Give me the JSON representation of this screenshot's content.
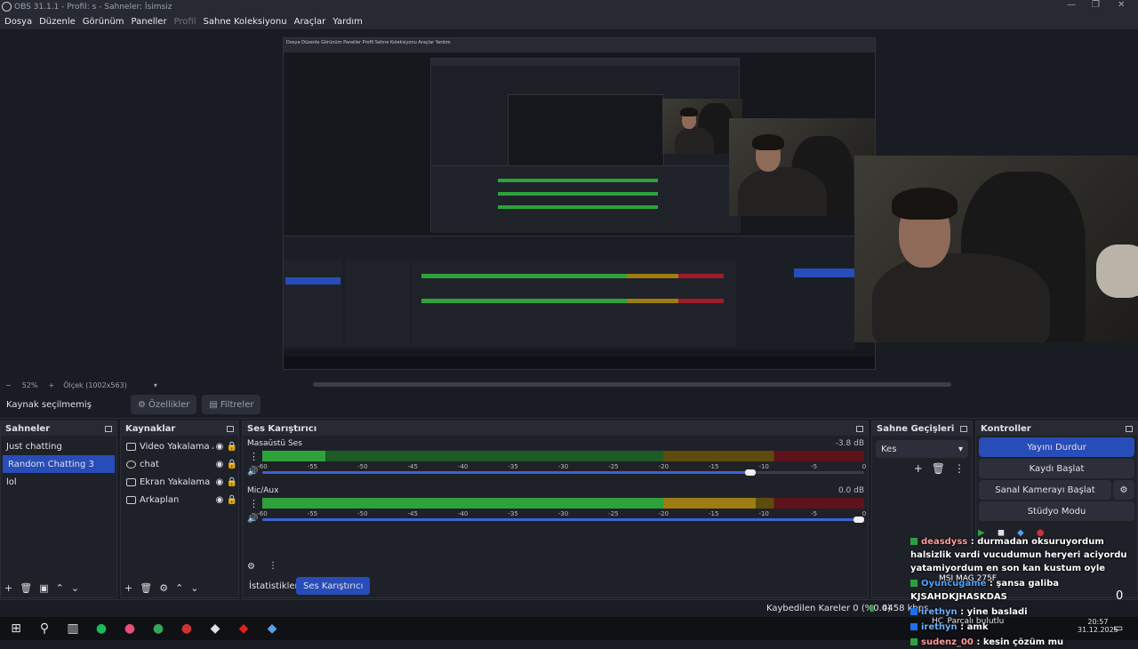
{
  "window": {
    "title": "OBS 31.1.1 - Profil: s - Sahneler: İsimsiz"
  },
  "menu": [
    "Dosya",
    "Düzenle",
    "Görünüm",
    "Paneller",
    "Profil",
    "Sahne Koleksiyonu",
    "Araçlar",
    "Yardım"
  ],
  "preview": {
    "zoom": "52%",
    "scale_label": "Ölçek (1002x563)"
  },
  "nested_menu": [
    "Dosya",
    "Düzenle",
    "Görünüm",
    "Paneller",
    "Profil",
    "Sahne Koleksiyonu",
    "Araçlar",
    "Yardım"
  ],
  "source_toolbar": {
    "no_source": "Kaynak seçilmemiş",
    "properties": "Özellikler",
    "filters": "Filtreler"
  },
  "scenes": {
    "title": "Sahneler",
    "items": [
      "Just chatting",
      "Random Chatting 3",
      "lol"
    ],
    "selected_index": 1
  },
  "sources": {
    "title": "Kaynaklar",
    "items": [
      {
        "label": "Video Yakalama Aygıtı",
        "icon": "camera-icon"
      },
      {
        "label": "chat",
        "icon": "browser-icon"
      },
      {
        "label": "Ekran Yakalama",
        "icon": "monitor-icon"
      },
      {
        "label": "Arkaplan",
        "icon": "image-icon"
      }
    ]
  },
  "mixer": {
    "title": "Ses Karıştırıcı",
    "channels": [
      {
        "name": "Masaüstü Ses",
        "db": "-3.8 dB",
        "level": 0.105,
        "volume": 0.82
      },
      {
        "name": "Mic/Aux",
        "db": "0.0 dB",
        "level": 0.82,
        "volume": 1.0
      }
    ],
    "ticks": [
      "-60",
      "-55",
      "-50",
      "-45",
      "-40",
      "-35",
      "-30",
      "-25",
      "-20",
      "-15",
      "-10",
      "-5",
      "0"
    ]
  },
  "tabs": {
    "stats": "İstatistikler",
    "mixer": "Ses Karıştırıcı"
  },
  "transitions": {
    "title": "Sahne Geçişleri",
    "selected": "Kes"
  },
  "controls": {
    "title": "Kontroller",
    "stop_stream": "Yayını Durdur",
    "start_record": "Kaydı Başlat",
    "virtual_cam": "Sanal Kamerayı Başlat",
    "studio_mode": "Stüdyo Modu"
  },
  "status": {
    "dropped": "Kaybedilen Kareler 0 (%0.0)",
    "bitrate": "4458 kbps"
  },
  "chat": [
    {
      "user": "deasdyss",
      "msg": "durmadan oksuruyordum halsizlik vardi vucudumun heryeri aciyordu yatamiyordum en son kan kustum oyle"
    },
    {
      "user": "Oyuncugame",
      "msg": "şansa galiba KJSAHDKJHASKDAS"
    },
    {
      "user": "irethyn",
      "msg": "yine basladi"
    },
    {
      "user": "irethyn",
      "msg": "amk"
    },
    {
      "user": "sudenz_00",
      "msg": "kesin çözüm mu"
    }
  ],
  "overlay": {
    "monitor": "MSI MAG 275F",
    "count": "0",
    "parts": "HC_Parçalı bulutlu"
  },
  "clock": {
    "time": "20:57",
    "date": "31.12.2025"
  },
  "colors": {
    "accent": "#284cb8",
    "meter_green": "#2ea23a",
    "meter_yellow": "#9c7d14",
    "meter_red": "#9e1c28"
  }
}
